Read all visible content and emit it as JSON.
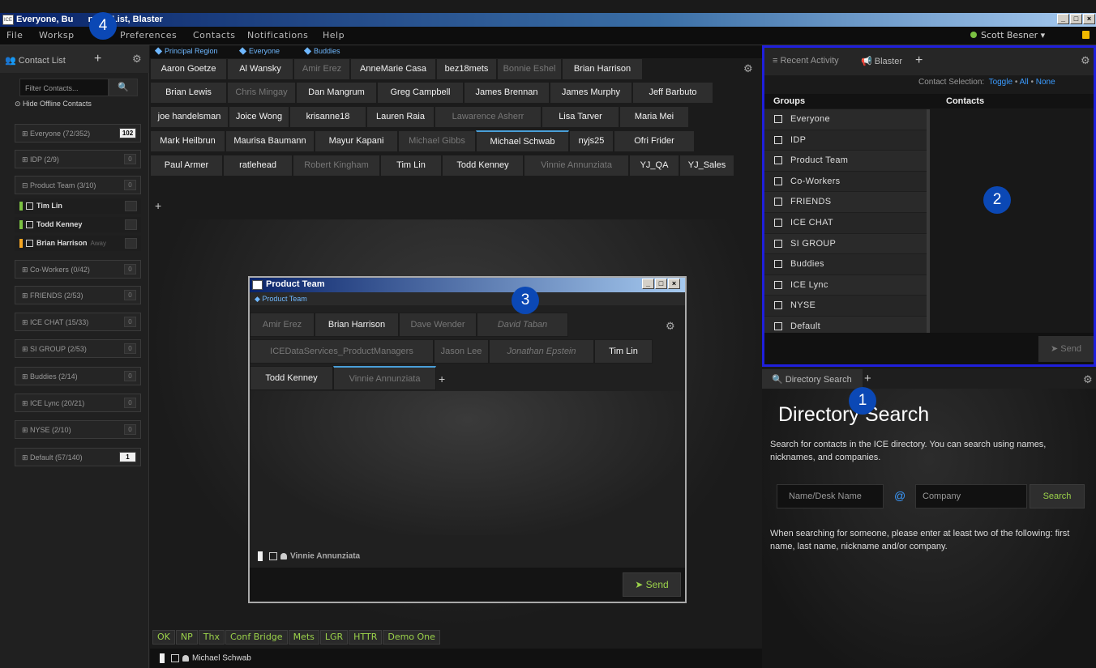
{
  "window": {
    "title": "Everyone, Bu",
    "title_rest": "ntact List, Blaster",
    "app_icon": "ICE"
  },
  "menu": {
    "items": [
      "File",
      "Worksp",
      "Preferences",
      "Contacts",
      "Notifications",
      "Help"
    ],
    "user": "Scott Besner ▾"
  },
  "sidebar": {
    "tab_label": "Contact List",
    "filter_placeholder": "Filter Contacts...",
    "hide_offline": "Hide Offline Contacts",
    "groups": [
      {
        "label": "⊞ Everyone (72/352)",
        "count": "102"
      },
      {
        "label": "⊞ IDP (2/9)",
        "count": "0"
      },
      {
        "label": "⊟ Product Team (3/10)",
        "count": "0"
      },
      {
        "label": "⊞ Co-Workers (0/42)",
        "count": "0"
      },
      {
        "label": "⊞ FRIENDS (2/53)",
        "count": "0"
      },
      {
        "label": "⊞ ICE CHAT (15/33)",
        "count": "0"
      },
      {
        "label": "⊞ SI GROUP (2/53)",
        "count": "0"
      },
      {
        "label": "⊞ Buddies (2/14)",
        "count": "0"
      },
      {
        "label": "⊞ ICE Lync (20/21)",
        "count": "0"
      },
      {
        "label": "⊞ NYSE (2/10)",
        "count": "0"
      },
      {
        "label": "⊞ Default (57/140)",
        "count": "1"
      }
    ],
    "members": [
      {
        "name": "Tim Lin",
        "status": "available",
        "away": ""
      },
      {
        "name": "Todd Kenney",
        "status": "available",
        "away": ""
      },
      {
        "name": "Brian Harrison",
        "status": "away",
        "away": "Away"
      }
    ]
  },
  "center": {
    "tabs": [
      "Principal Region",
      "Everyone",
      "Buddies"
    ],
    "contacts": [
      [
        "Aaron Goetze",
        "Al Wansky",
        "Amir Erez",
        "AnneMarie Casa",
        "bez18mets",
        "Bonnie Eshel",
        "Brian Harrison"
      ],
      [
        "Brian Lewis",
        "Chris Mingay",
        "Dan Mangrum",
        "Greg Campbell",
        "James Brennan",
        "James Murphy",
        "Jeff Barbuto"
      ],
      [
        "joe handelsman",
        "Joice Wong",
        "krisanne18",
        "Lauren Raia",
        "Lawarence Asherr",
        "Lisa Tarver",
        "Maria Mei"
      ],
      [
        "Mark Heilbrun",
        "Maurisa Baumann",
        "Mayur Kapani",
        "Michael Gibbs",
        "Michael Schwab",
        "nyjs25",
        "Ofri Frider"
      ],
      [
        "Paul Armer",
        "ratlehead",
        "Robert Kingham",
        "Tim Lin",
        "Todd Kenney",
        "Vinnie Annunziata",
        "YJ_QA",
        "YJ_Sales"
      ]
    ],
    "quick_replies": [
      "OK",
      "NP",
      "Thx",
      "Conf Bridge",
      "Mets",
      "LGR",
      "HTTR",
      "Demo One"
    ],
    "status_contact": "Michael Schwab"
  },
  "product_team": {
    "title": "Product Team",
    "tab": "Product Team",
    "row1": [
      "Amir Erez",
      "Brian Harrison",
      "Dave Wender",
      "David Taban"
    ],
    "row2": [
      "ICEDataServices_ProductManagers",
      "Jason Lee",
      "Jonathan Epstein",
      "Tim Lin"
    ],
    "row3": [
      "Todd Kenney",
      "Vinnie Annunziata"
    ],
    "status_contact": "Vinnie Annunziata",
    "send": "Send"
  },
  "blaster": {
    "tabs": [
      "Recent Activity",
      "Blaster"
    ],
    "selection_label": "Contact Selection:",
    "toggle": "Toggle",
    "all": "All",
    "none": "None",
    "sep": "•",
    "col_groups": "Groups",
    "col_contacts": "Contacts",
    "groups": [
      "Everyone",
      "IDP",
      "Product Team",
      "Co-Workers",
      "FRIENDS",
      "ICE CHAT",
      "SI GROUP",
      "Buddies",
      "ICE Lync",
      "NYSE",
      "Default"
    ],
    "send": "Send"
  },
  "directory": {
    "tab": "Directory Search",
    "title": "Directory Search",
    "desc": "Search for contacts in the ICE directory. You can search using names, nicknames, and companies.",
    "name_placeholder": "Name/Desk Name",
    "at": "@",
    "company_placeholder": "Company",
    "search": "Search",
    "hint": "When searching for someone, please enter at least two of the following: first name, last name, nickname and/or company."
  },
  "callouts": [
    "1",
    "2",
    "3",
    "4"
  ],
  "colors": {
    "accent_green": "#9bd24a",
    "link_blue": "#3a9bff",
    "highlight_border": "#1f1fdc",
    "callout_blue": "#0b48b5"
  }
}
